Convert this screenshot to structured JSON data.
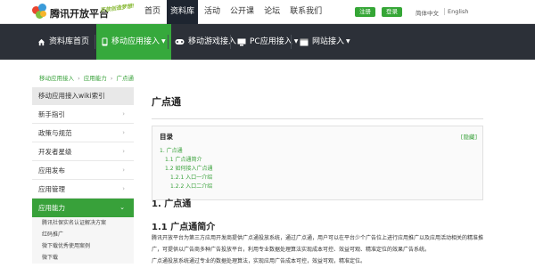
{
  "header": {
    "brand": "腾讯开放平台",
    "slogan": "开放创造梦想!",
    "nav": [
      "首页",
      "资料库",
      "活动",
      "公开课",
      "论坛",
      "联系我们"
    ],
    "active_nav": "资料库",
    "register": "注册",
    "login": "登录",
    "lang_cn": "简体中文",
    "lang_en": "English"
  },
  "mainnav": {
    "items": [
      "资料库首页",
      "移动应用接入",
      "移动游戏接入",
      "PC应用接入",
      "网站接入"
    ],
    "active": "移动应用接入"
  },
  "breadcrumb": [
    "移动应用接入",
    "应用能力",
    "广点通"
  ],
  "sidebar": {
    "head": "移动应用接入wiki索引",
    "items": [
      "新手指引",
      "政策与规范",
      "开发者星级",
      "应用发布",
      "应用管理",
      "应用能力"
    ],
    "active": "应用能力",
    "subitems": [
      "腾讯社保实名认证解决方案",
      "红码推广",
      "微下载优秀使用案例",
      "微下载"
    ]
  },
  "content": {
    "title": "广点通",
    "toc_title": "目录",
    "toc_hide": "[隐藏]",
    "toc": [
      "1. 广点通",
      "1.1 广点通简介",
      "1.2 如何接入广点通",
      "1.2.1 入口一介绍",
      "1.2.2 入口二介绍"
    ],
    "h2": "1. 广点通",
    "h3": "1.1 广点通简介",
    "paragraphs": [
      "腾讯开放平台为第三方应用开发商提供广点通投放系统，通过广点通，用户可以在平台少个广告位上进行应用推广以及应用活动相关的精准推",
      "广，可提供以广告商多种广告投放平台，利用专业数据处理算法实现成本可控、效益可观、精准定位的效果广告系统。",
      "广点通投放系统通过专业的数据处理算法，实现应用广告成本可控，效益可观，精准定位。"
    ]
  },
  "colors": {
    "accent": "#38a13a",
    "nav_dark": "#2c3038"
  }
}
